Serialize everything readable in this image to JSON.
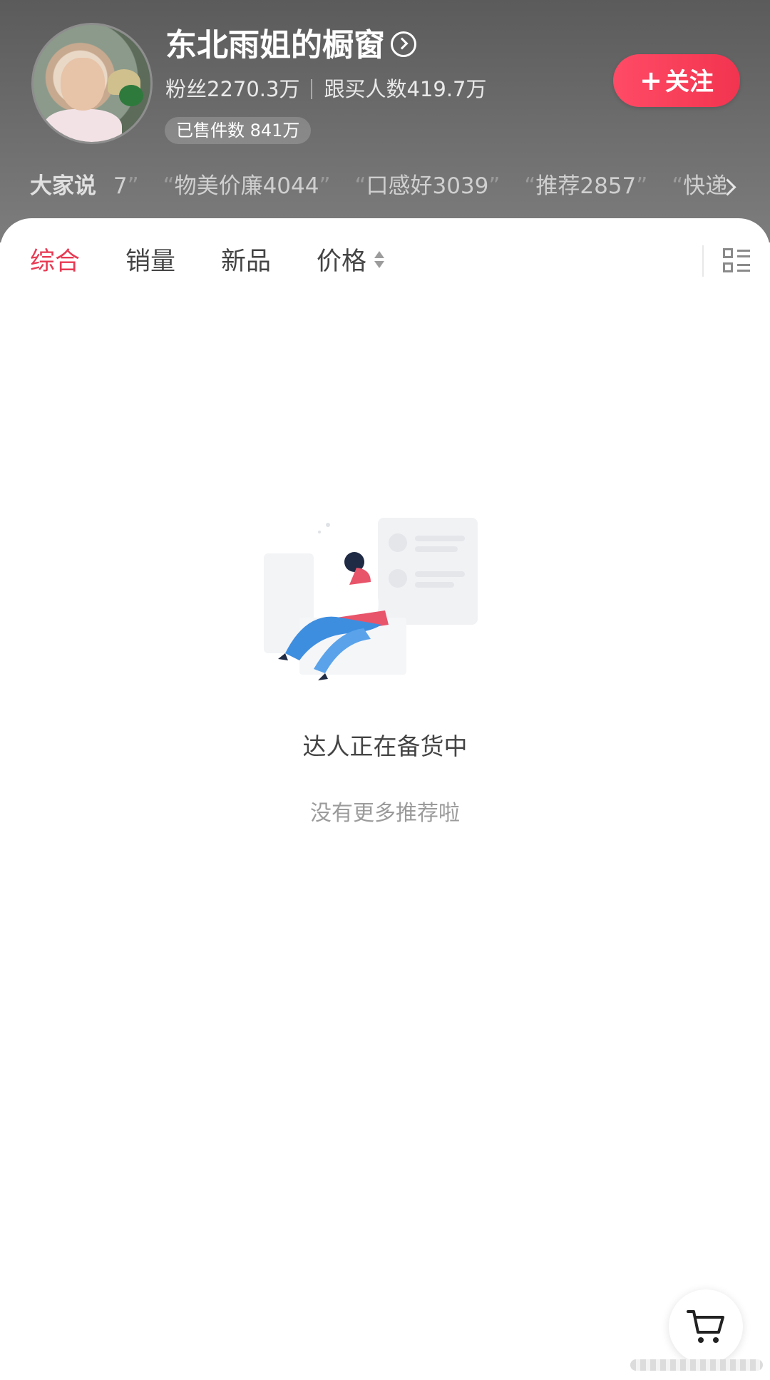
{
  "header": {
    "shop_name": "东北雨姐的橱窗",
    "followers": "粉丝2270.3万",
    "buyers": "跟买人数419.7万",
    "sold": "已售件数 841万",
    "follow_label": "关注",
    "reviews_lead": "大家说",
    "reviews": [
      "7",
      "物美价廉4044",
      "口感好3039",
      "推荐2857",
      "快递"
    ]
  },
  "tabs": [
    "综合",
    "销量",
    "新品",
    "价格"
  ],
  "active_tab": 0,
  "empty_state": {
    "title": "达人正在备货中",
    "subtitle": "没有更多推荐啦"
  },
  "colors": {
    "accent": "#e83a53",
    "follow_button": "#f2344f",
    "header_bg": "#666666"
  },
  "icons": {
    "info": "chevron-right-circle-icon",
    "reviews_more": "chevron-right-icon",
    "sort": "sort-updown-icon",
    "layout": "list-layout-icon",
    "cart": "cart-icon"
  }
}
